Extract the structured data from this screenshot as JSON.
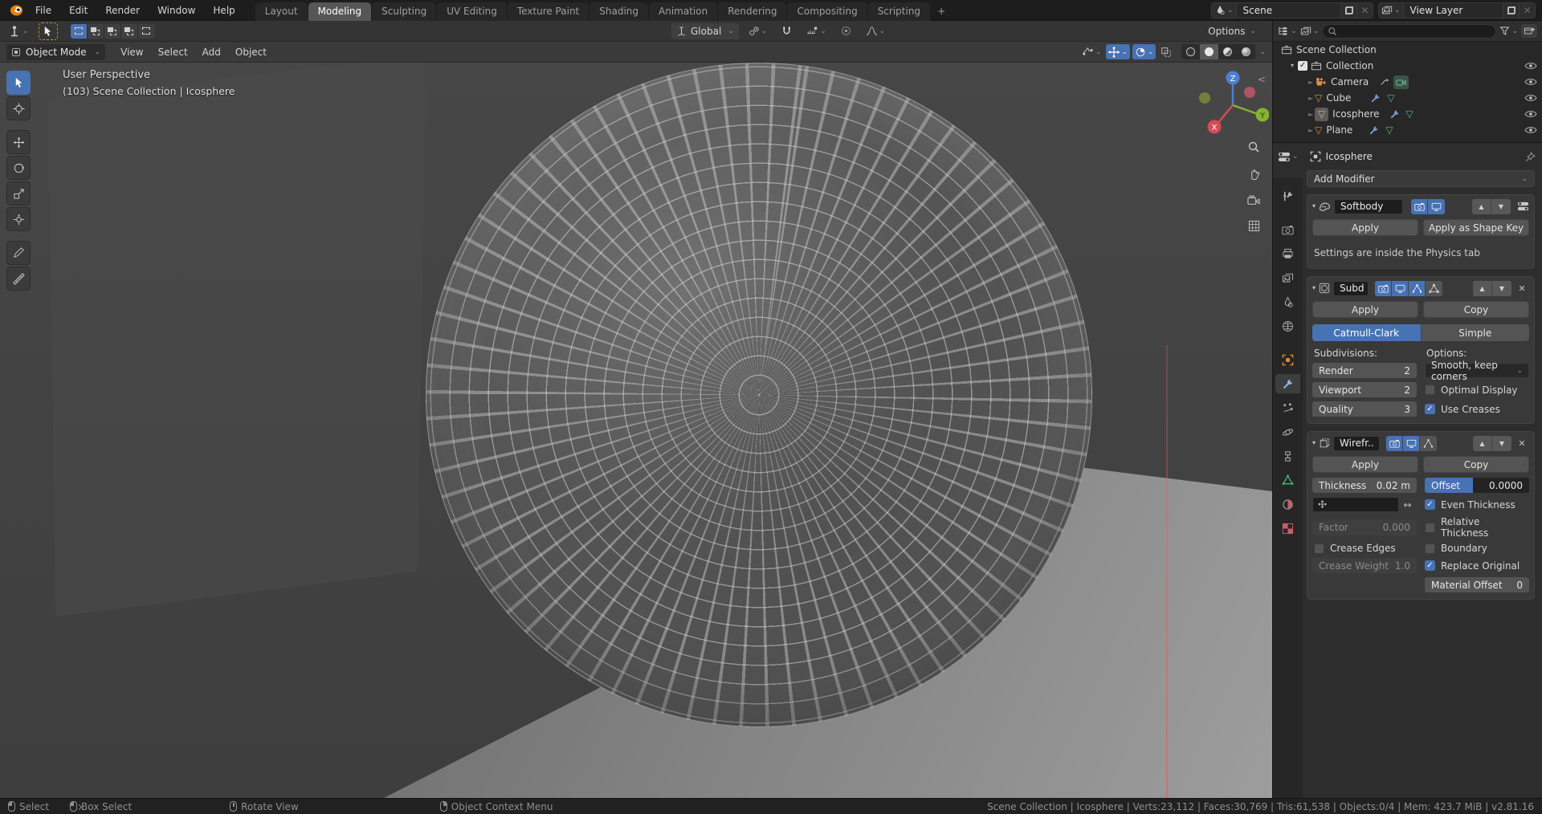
{
  "icons": {
    "dropdown": "⌄",
    "disclosure": "▾",
    "up_arrow": "▲",
    "down_arrow": "▼",
    "close": "✕",
    "swap_axis": "↔",
    "check": "✓",
    "plus": "+",
    "collapse_left": "<",
    "mesh_triangle": "▽"
  },
  "topbar": {
    "menus": [
      "File",
      "Edit",
      "Render",
      "Window",
      "Help"
    ],
    "workspaces": [
      "Layout",
      "Modeling",
      "Sculpting",
      "UV Editing",
      "Texture Paint",
      "Shading",
      "Animation",
      "Rendering",
      "Compositing",
      "Scripting"
    ],
    "active_workspace": "Modeling",
    "scene_selector": {
      "value": "Scene"
    },
    "view_layer_selector": {
      "value": "View Layer"
    }
  },
  "tool_settings": {
    "orientation": "Global",
    "options_label": "Options"
  },
  "viewport_header": {
    "mode": "Object Mode",
    "menus": [
      "View",
      "Select",
      "Add",
      "Object"
    ]
  },
  "viewport": {
    "overlay_line1": "User Perspective",
    "overlay_line2": "(103) Scene Collection | Icosphere",
    "gizmo": {
      "x": "X",
      "y": "Y",
      "z": "Z"
    }
  },
  "outliner": {
    "root": "Scene Collection",
    "rows": [
      {
        "label": "Collection"
      },
      {
        "label": "Camera"
      },
      {
        "label": "Cube"
      },
      {
        "label": "Icosphere"
      },
      {
        "label": "Plane"
      }
    ]
  },
  "properties": {
    "breadcrumb": "Icosphere",
    "add_modifier_label": "Add Modifier",
    "tabs": [
      "tool",
      "render",
      "output",
      "view-layer",
      "scene",
      "world",
      "object",
      "modifiers",
      "particles",
      "physics",
      "constraints",
      "object-data",
      "material",
      "texture"
    ],
    "active_tab": "modifiers",
    "modifiers": [
      {
        "name": "Softbody",
        "apply_label": "Apply",
        "apply_shape_key_label": "Apply as Shape Key",
        "note": "Settings are inside the Physics tab"
      },
      {
        "name": "Subd",
        "apply_label": "Apply",
        "copy_label": "Copy",
        "type_options": [
          "Catmull-Clark",
          "Simple"
        ],
        "active_type": "Catmull-Clark",
        "subdivisions_label": "Subdivisions:",
        "options_label": "Options:",
        "fields": [
          {
            "label": "Render",
            "value": "2"
          },
          {
            "label": "Viewport",
            "value": "2"
          },
          {
            "label": "Quality",
            "value": "3"
          }
        ],
        "uv_smooth_value": "Smooth, keep corners",
        "checkboxes": [
          {
            "label": "Optimal Display",
            "checked": false
          },
          {
            "label": "Use Creases",
            "checked": true
          }
        ]
      },
      {
        "name": "Wirefr..",
        "apply_label": "Apply",
        "copy_label": "Copy",
        "thickness_label": "Thickness",
        "thickness_value": "0.02 m",
        "offset_label": "Offset",
        "offset_value": "0.0000",
        "factor_label": "Factor",
        "factor_value": "0.000",
        "crease_edges_label": "Crease Edges",
        "crease_weight_label": "Crease Weight",
        "crease_weight_value": "1.0",
        "material_offset_label": "Material Offset",
        "material_offset_value": "0",
        "checkboxes": [
          {
            "label": "Even Thickness",
            "checked": true
          },
          {
            "label": "Relative Thickness",
            "checked": false
          },
          {
            "label": "Boundary",
            "checked": false
          },
          {
            "label": "Replace Original",
            "checked": true
          }
        ]
      }
    ]
  },
  "status_bar": {
    "left": [
      {
        "label": "Select"
      },
      {
        "label": "Box Select"
      },
      {
        "label": "Rotate View"
      },
      {
        "label": "Object Context Menu"
      }
    ],
    "stats": "Scene Collection | Icosphere | Verts:23,112 | Faces:30,769 | Tris:61,538 | Objects:0/4 | Mem: 423.7 MiB | v2.81.16"
  },
  "colors": {
    "accent_blue": "#4772b3",
    "selected_orange": "#e0913f",
    "mesh_data_green": "#47c07a"
  }
}
